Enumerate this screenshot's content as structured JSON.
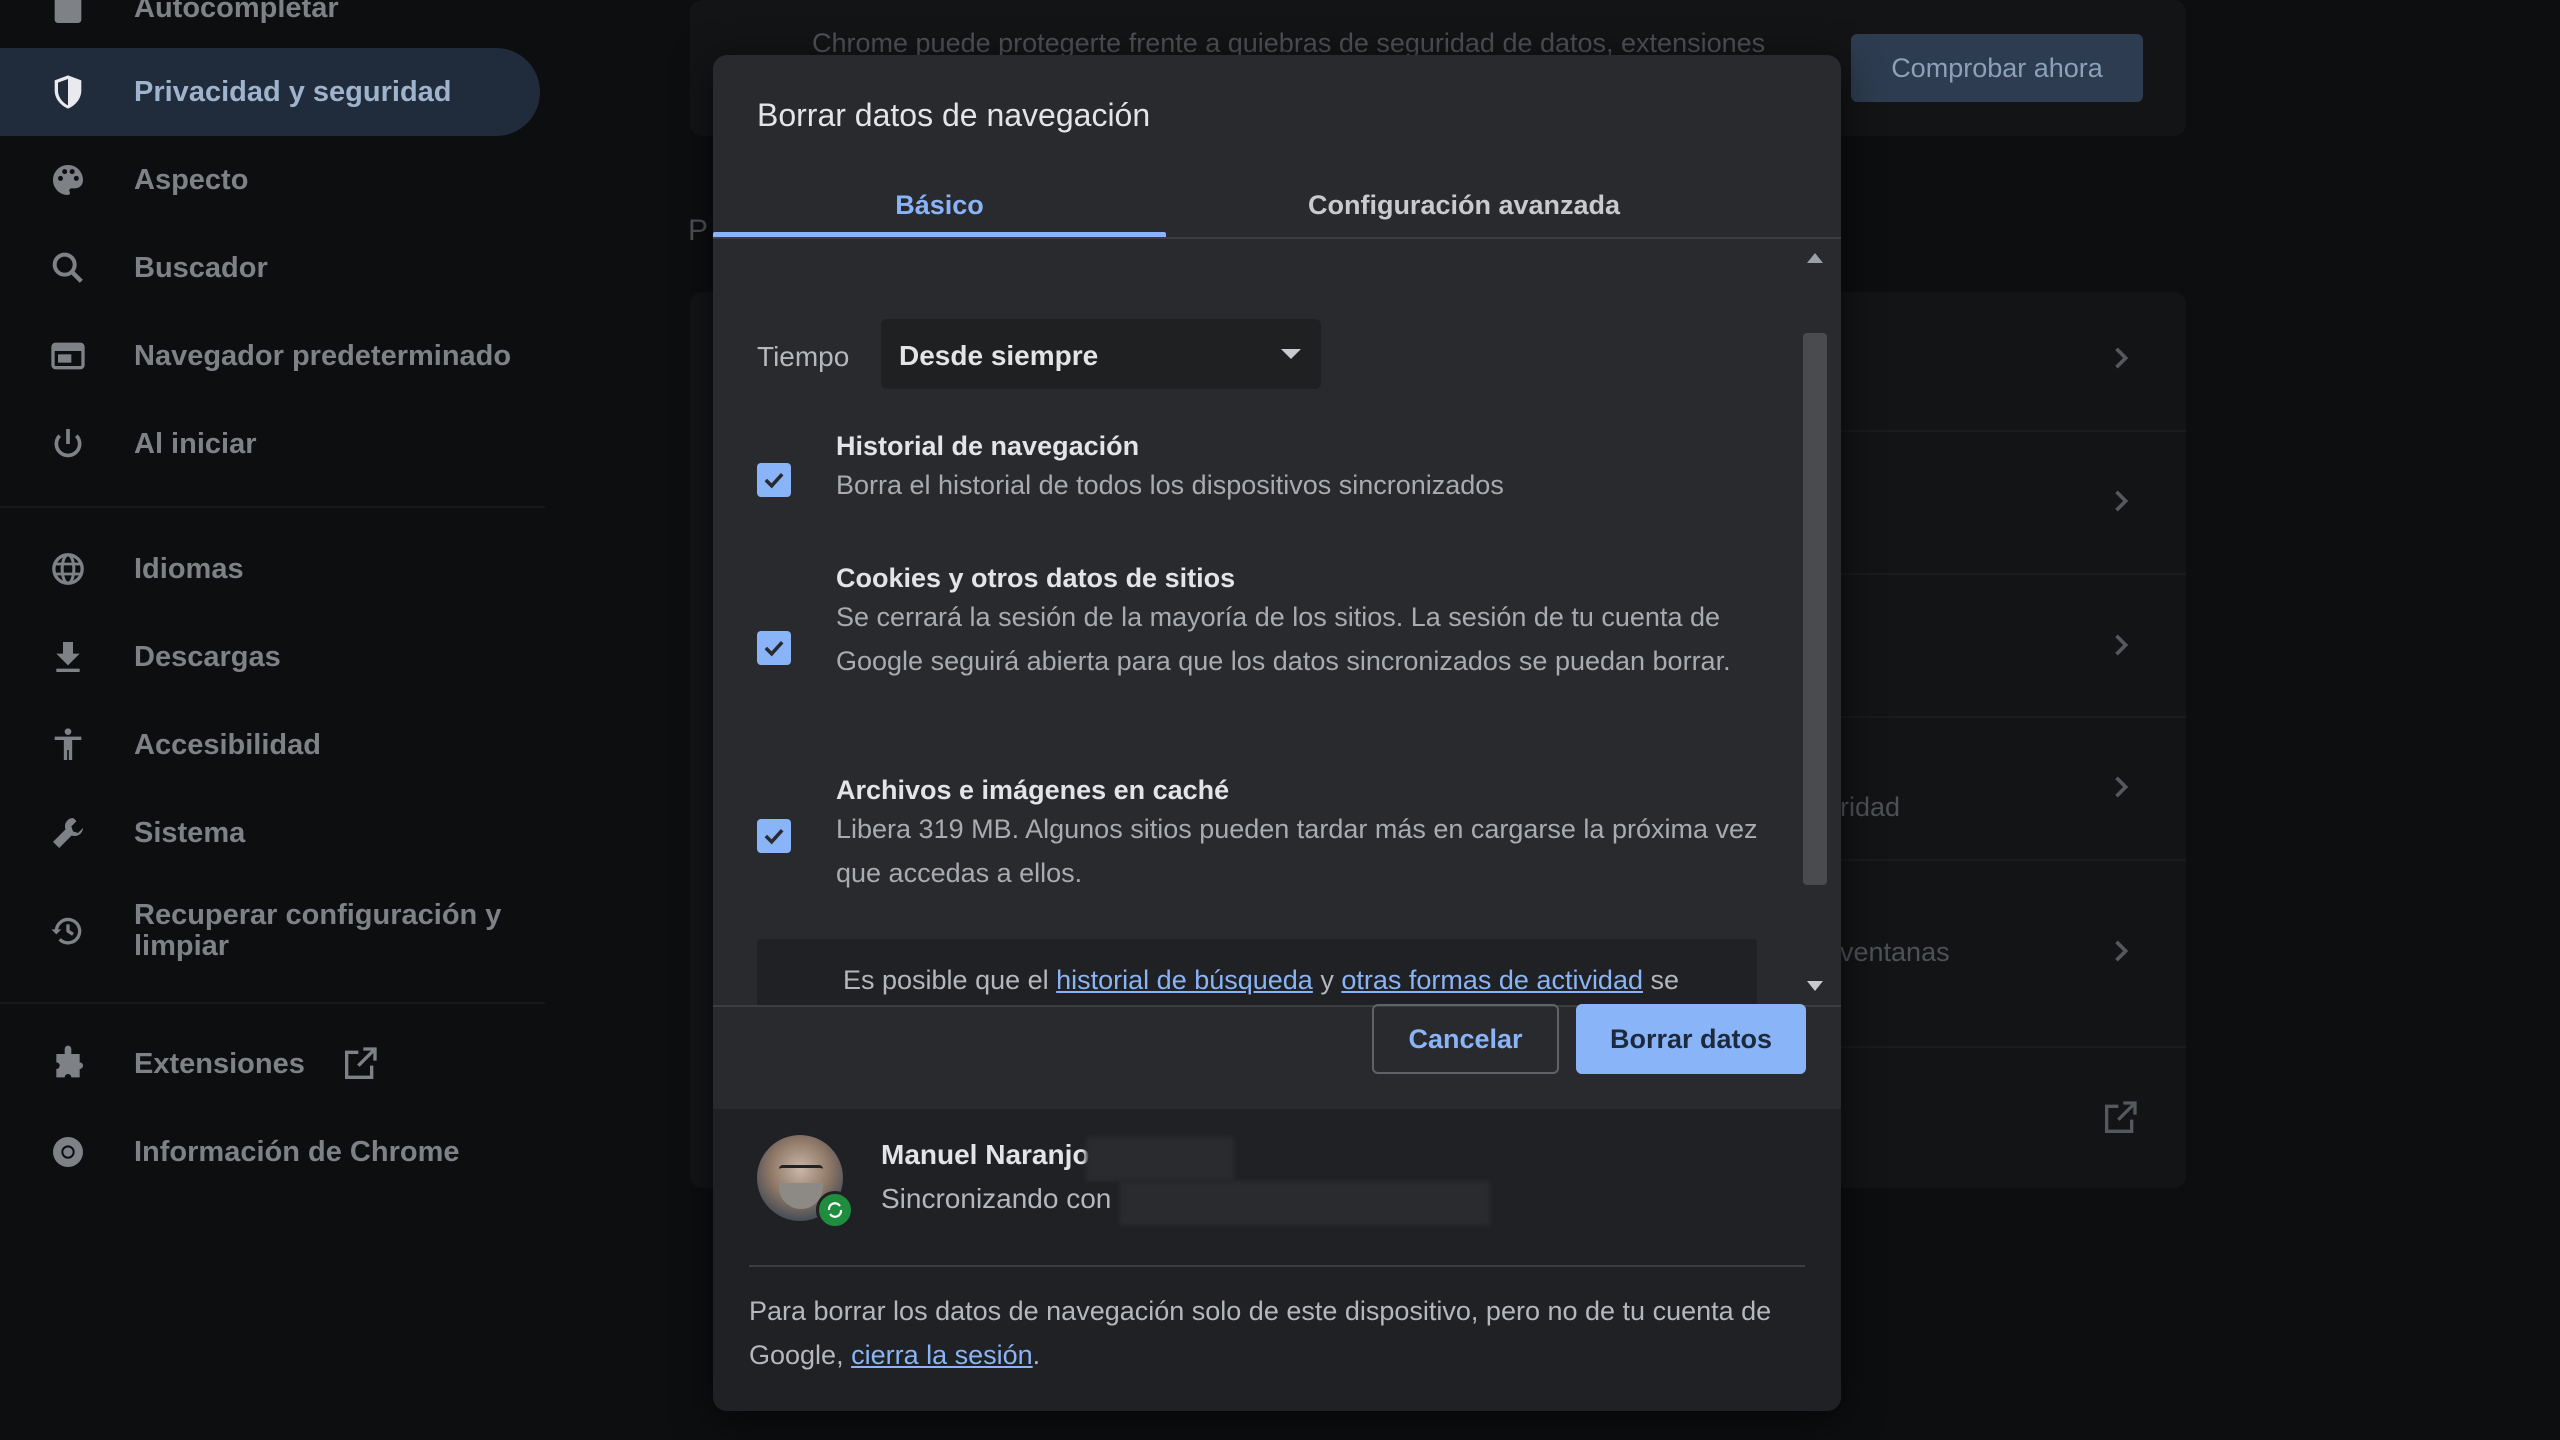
{
  "sidebar": {
    "items": [
      {
        "label": "Autocompletar"
      },
      {
        "label": "Privacidad y seguridad"
      },
      {
        "label": "Aspecto"
      },
      {
        "label": "Buscador"
      },
      {
        "label": "Navegador predeterminado"
      },
      {
        "label": "Al iniciar"
      },
      {
        "label": "Idiomas"
      },
      {
        "label": "Descargas"
      },
      {
        "label": "Accesibilidad"
      },
      {
        "label": "Sistema"
      },
      {
        "label": "Recuperar configuración y limpiar"
      },
      {
        "label": "Extensiones"
      },
      {
        "label": "Información de Chrome"
      }
    ]
  },
  "background": {
    "safety_text": "Chrome puede protegerte frente a quiebras de seguridad de datos, extensiones",
    "check_now_button": "Comprobar ahora",
    "section_initial": "P",
    "row_fragment_1": "ridad",
    "row_fragment_2": "ventanas"
  },
  "dialog": {
    "title": "Borrar datos de navegación",
    "tabs": [
      {
        "label": "Básico",
        "active": true
      },
      {
        "label": "Configuración avanzada",
        "active": false
      }
    ],
    "time_range": {
      "label": "Tiempo",
      "value": "Desde siempre"
    },
    "options": [
      {
        "title": "Historial de navegación",
        "description": "Borra el historial de todos los dispositivos sincronizados",
        "checked": true
      },
      {
        "title": "Cookies y otros datos de sitios",
        "description": "Se cerrará la sesión de la mayoría de los sitios. La sesión de tu cuenta de Google seguirá abierta para que los datos sincronizados se puedan borrar.",
        "checked": true
      },
      {
        "title": "Archivos e imágenes en caché",
        "description": "Libera 319 MB. Algunos sitios pueden tardar más en cargarse la próxima vez que accedas a ellos.",
        "checked": true
      }
    ],
    "notice": {
      "prefix": "Es posible que el ",
      "link1": "historial de búsqueda",
      "middle": " y ",
      "link2": "otras formas de actividad",
      "suffix": " se"
    },
    "cancel_button": "Cancelar",
    "confirm_button": "Borrar datos",
    "account": {
      "name": "Manuel Naranjo",
      "sync_status": "Sincronizando con"
    },
    "footer": {
      "text": "Para borrar los datos de navegación solo de este dispositivo, pero no de tu cuenta de Google, ",
      "link": "cierra la sesión",
      "end": "."
    }
  },
  "colors": {
    "accent": "#8ab4f8",
    "dialog_bg": "#292a2d",
    "page_bg": "#0d0e10"
  }
}
